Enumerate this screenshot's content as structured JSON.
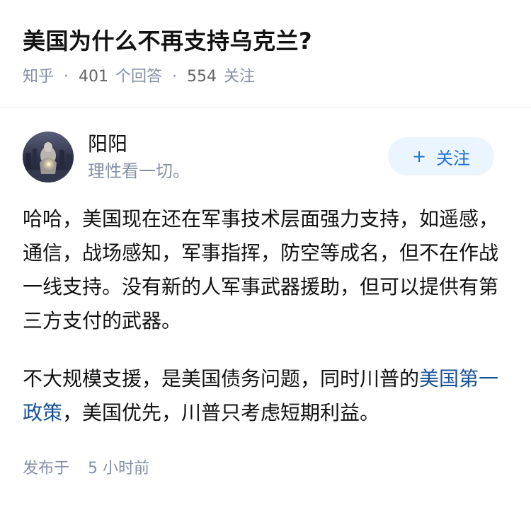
{
  "question": {
    "title": "美国为什么不再支持乌克兰?",
    "source": "知乎",
    "separator": "·",
    "answer_count": "401",
    "answer_label": "个回答",
    "follower_count": "554",
    "follower_label": "关注"
  },
  "author": {
    "name": "阳阳",
    "bio": "理性看一切。",
    "avatar_icon": "avatar-photo"
  },
  "follow_button": {
    "icon": "+",
    "label": "关注"
  },
  "answer": {
    "paragraph1": "哈哈，美国现在还在军事技术层面强力支持，如遥感，通信，战场感知，军事指挥，防空等成名，但不在作战一线支持。没有新的人军事武器援助，但可以提供有第三方支付的武器。",
    "paragraph2_before": "不大规模支援，是美国债务问题，同时川普的",
    "paragraph2_link": "美国第一政策",
    "paragraph2_after": "，美国优先，川普只考虑短期利益。"
  },
  "footer": {
    "published_label": "发布于",
    "time_value": "5",
    "time_unit": "小时前"
  },
  "colors": {
    "link": "#175199",
    "meta": "#8590a6",
    "follow_bg": "#ebf5ff",
    "follow_text": "#1a6fd6"
  }
}
